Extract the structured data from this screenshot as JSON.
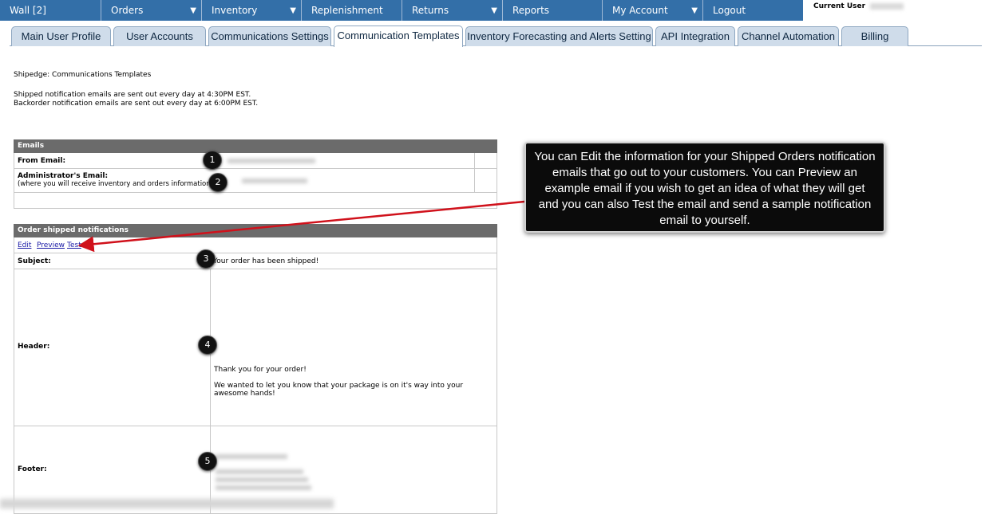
{
  "nav": {
    "items": [
      {
        "label": "Wall [2]",
        "dropdown": false
      },
      {
        "label": "Orders",
        "dropdown": true
      },
      {
        "label": "Inventory",
        "dropdown": true
      },
      {
        "label": "Replenishment",
        "dropdown": false
      },
      {
        "label": "Returns",
        "dropdown": true
      },
      {
        "label": "Reports",
        "dropdown": false
      },
      {
        "label": "My Account",
        "dropdown": true
      },
      {
        "label": "Logout",
        "dropdown": false
      }
    ],
    "caret": "▼",
    "current_user_label": "Current User"
  },
  "tabs": [
    {
      "label": "Main User Profile"
    },
    {
      "label": "User Accounts"
    },
    {
      "label": "Communications Settings"
    },
    {
      "label": "Communication Templates",
      "active": true
    },
    {
      "label": "Inventory Forecasting and Alerts Setting"
    },
    {
      "label": "API Integration"
    },
    {
      "label": "Channel Automation"
    },
    {
      "label": "Billing"
    }
  ],
  "intro": {
    "title": "Shipedge: Communications Templates",
    "line1": "Shipped notification emails are sent out every day at 4:30PM EST.",
    "line2": "Backorder notification emails are sent out every day at 6:00PM EST."
  },
  "emails": {
    "header": "Emails",
    "from_label": "From Email:",
    "admin_label": "Administrator's Email:",
    "admin_sub": "(where you will receive inventory and orders information)"
  },
  "shipped": {
    "header": "Order shipped notifications",
    "edit": "Edit",
    "preview": "Preview",
    "test": "Test",
    "subject_label": "Subject:",
    "subject_value": "Your order has been shipped!",
    "header_label": "Header:",
    "header_line1": "Thank you for your order!",
    "header_line2": "We wanted to let you know that your package is on it's way into your awesome hands!",
    "footer_label": "Footer:"
  },
  "badges": [
    "1",
    "2",
    "3",
    "4",
    "5"
  ],
  "callout": "You can Edit the information for your Shipped Orders notification emails that go out to your customers. You can Preview an example email if you wish to get an idea of what they will get and you can also Test the email and send a sample notification email to yourself.",
  "colors": {
    "nav": "#336fa8",
    "tab": "#cfdcea",
    "table_header": "#6b6b6b",
    "arrow": "#d0111b"
  }
}
